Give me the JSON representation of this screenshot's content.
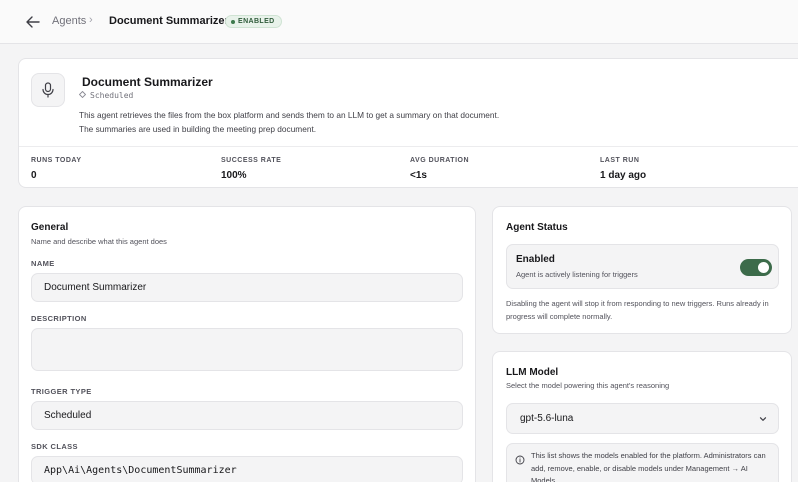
{
  "header": {
    "breadcrumb_parent": "Agents",
    "breadcrumb_separator": "›",
    "breadcrumb_current": "Document Summarizer",
    "status_badge": "ENABLED"
  },
  "hero": {
    "title": "Document Summarizer",
    "subtitle": "Scheduled",
    "description_line1": "This agent retrieves the files from the box platform and sends them to an LLM to get a summary on that document.",
    "description_line2": "The summaries are used in building the meeting prep document.",
    "stats": [
      {
        "label": "RUNS TODAY",
        "value": "0"
      },
      {
        "label": "SUCCESS RATE",
        "value": "100%"
      },
      {
        "label": "AVG DURATION",
        "value": "<1s"
      },
      {
        "label": "LAST RUN",
        "value": "1 day ago"
      }
    ]
  },
  "general": {
    "title": "General",
    "subtitle": "Name and describe what this agent does",
    "name_label": "NAME",
    "name_value": "Document Summarizer",
    "description_label": "DESCRIPTION",
    "description_value": "",
    "trigger_label": "TRIGGER TYPE",
    "trigger_value": "Scheduled",
    "sdk_label": "SDK CLASS",
    "sdk_value": "App\\Ai\\Agents\\DocumentSummarizer"
  },
  "agent_status": {
    "title": "Agent Status",
    "state_title": "Enabled",
    "state_sub": "Agent is actively listening for triggers",
    "toggle_on": true,
    "note": "Disabling the agent will stop it from responding to new triggers. Runs already in progress will complete normally."
  },
  "llm": {
    "title": "LLM Model",
    "subtitle": "Select the model powering this agent's reasoning",
    "selected_model": "gpt-5.6-luna",
    "info": "This list shows the models enabled for the platform. Administrators can add, remove, enable, or disable models under Management → AI Models."
  },
  "colors": {
    "accent_green": "#3c6b4a",
    "badge_bg": "#e8f2ea"
  },
  "icons": {
    "back": "arrow-left-icon",
    "agent": "microphone-icon",
    "schedule": "diamond-icon",
    "select": "chevron-down-icon",
    "info": "info-circle-icon"
  }
}
